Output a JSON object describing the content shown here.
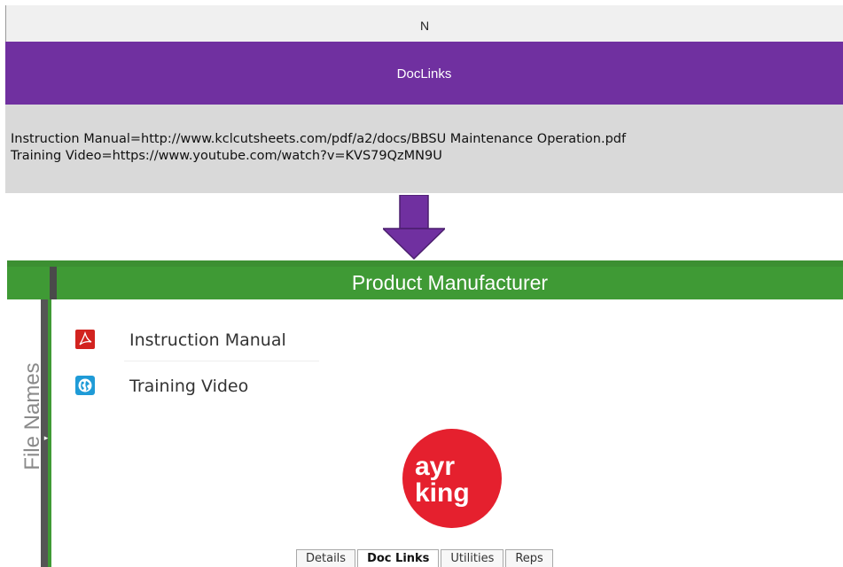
{
  "spreadsheet": {
    "column_letter": "N",
    "column_title": "DocLinks",
    "cell_lines": [
      "Instruction Manual=http://www.kclcutsheets.com/pdf/a2/docs/BBSU Maintenance Operation.pdf",
      "Training Video=https://www.youtube.com/watch?v=KVS79QzMN9U"
    ],
    "colors": {
      "header_bg": "#f0f0f0",
      "title_band": "#7030a0",
      "cell_bg": "#d9d9d9"
    }
  },
  "arrow": {
    "color": "#7030a0",
    "icon": "arrow-down-icon"
  },
  "app": {
    "title": "Product Manufacturer",
    "side_label": "File Names",
    "side_toggle_icon": "triangle-right-icon",
    "links": [
      {
        "label": "Instruction Manual",
        "icon": "pdf-icon"
      },
      {
        "label": "Training Video",
        "icon": "globe-icon"
      }
    ],
    "logo": {
      "line1": "ayr",
      "line2": "king",
      "color": "#e5202e",
      "icon": "ayr-king-logo"
    },
    "tabs": [
      {
        "label": "Details",
        "active": false
      },
      {
        "label": "Doc Links",
        "active": true
      },
      {
        "label": "Utilities",
        "active": false
      },
      {
        "label": "Reps",
        "active": false
      }
    ],
    "colors": {
      "header_green": "#3f9a35",
      "divider": "#4a4a4a"
    }
  }
}
